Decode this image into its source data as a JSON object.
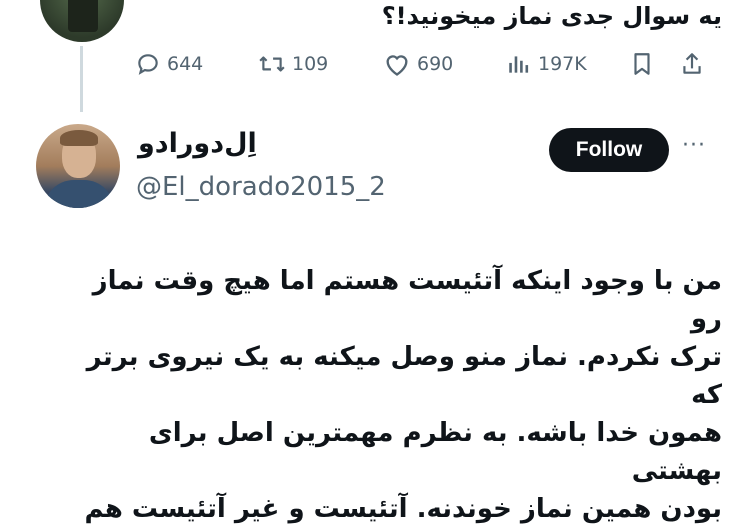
{
  "previous_tweet": {
    "text": "یه سوال جدی نماز میخونید!؟",
    "actions": {
      "replies": "644",
      "retweets": "109",
      "likes": "690",
      "views": "197K"
    }
  },
  "tweet": {
    "display_name": "اِل‌دورادو",
    "handle": "@El_dorado2015_2",
    "follow_label": "Follow",
    "more_label": "···",
    "body_lines": [
      "من با وجود اینکه آتئیست هستم اما هیچ وقت نماز رو",
      "ترک نکردم. نماز منو وصل میکنه به یک نیروی برتر که",
      "همون خدا باشه. به نظرم مهمترین اصل برای بهشتی",
      "بودن همین نماز خوندنه. آتئیست و غیر آتئیست هم"
    ]
  },
  "colors": {
    "text": "#0f1419",
    "secondary": "#536471",
    "follow_bg": "#0f1419",
    "thread_line": "#cfd9de"
  }
}
